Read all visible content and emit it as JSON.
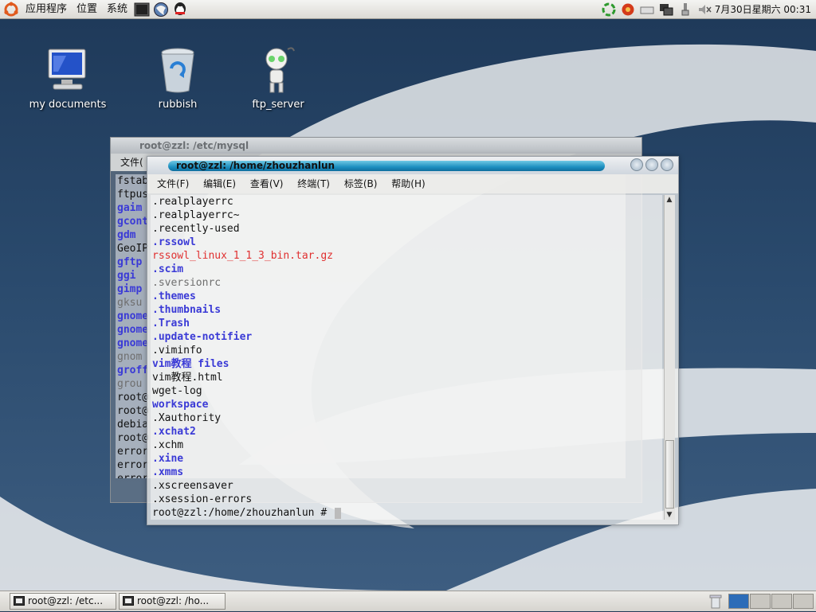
{
  "top_panel": {
    "menus": [
      "应用程序",
      "位置",
      "系统"
    ],
    "clock": "7月30日星期六 00:31"
  },
  "desktop_icons": [
    {
      "label": "my documents",
      "icon": "computer-icon"
    },
    {
      "label": "rubbish",
      "icon": "trash-icon"
    },
    {
      "label": "ftp_server",
      "icon": "robot-icon"
    }
  ],
  "window_mysql": {
    "title": "root@zzl: /etc/mysql",
    "menu_first": "文件(",
    "lines": [
      {
        "text": "fstab",
        "color": "white"
      },
      {
        "text": "ftpus",
        "color": "white"
      },
      {
        "text": "gaim",
        "color": "blue"
      },
      {
        "text": "gcont",
        "color": "blue"
      },
      {
        "text": "gdm",
        "color": "blue"
      },
      {
        "text": "GeoIP",
        "color": "white"
      },
      {
        "text": "gftp",
        "color": "blue"
      },
      {
        "text": "ggi",
        "color": "blue"
      },
      {
        "text": "gimp",
        "color": "blue"
      },
      {
        "text": "gksu",
        "color": "grey"
      },
      {
        "text": "gnome",
        "color": "blue"
      },
      {
        "text": "gnome",
        "color": "blue"
      },
      {
        "text": "gnome",
        "color": "blue"
      },
      {
        "text": "gnom",
        "color": "grey"
      },
      {
        "text": "groff",
        "color": "blue"
      },
      {
        "text": "grou",
        "color": "grey"
      },
      {
        "text": "root@",
        "color": "white"
      },
      {
        "text": "root@",
        "color": "white"
      },
      {
        "text": "debia",
        "color": "white"
      },
      {
        "text": "root@",
        "color": "white"
      },
      {
        "text": "error",
        "color": "white"
      },
      {
        "text": "error",
        "color": "white"
      },
      {
        "text": "error",
        "color": "white"
      }
    ]
  },
  "window_home": {
    "title": "root@zzl: /home/zhouzhanlun",
    "menu": [
      "文件(F)",
      "编辑(E)",
      "查看(V)",
      "终端(T)",
      "标签(B)",
      "帮助(H)"
    ],
    "lines": [
      {
        "text": ".realplayerrc",
        "color": "white"
      },
      {
        "text": ".realplayerrc~",
        "color": "white"
      },
      {
        "text": ".recently-used",
        "color": "white"
      },
      {
        "text": ".rssowl",
        "color": "blue"
      },
      {
        "text": "rssowl_linux_1_1_3_bin.tar.gz",
        "color": "red"
      },
      {
        "text": ".scim",
        "color": "blue"
      },
      {
        "text": ".sversionrc",
        "color": "grey"
      },
      {
        "text": ".themes",
        "color": "blue"
      },
      {
        "text": ".thumbnails",
        "color": "blue"
      },
      {
        "text": ".Trash",
        "color": "blue"
      },
      {
        "text": ".update-notifier",
        "color": "blue"
      },
      {
        "text": ".viminfo",
        "color": "white"
      },
      {
        "text": "vim教程 files",
        "color": "blue"
      },
      {
        "text": "vim教程.html",
        "color": "white"
      },
      {
        "text": "wget-log",
        "color": "white"
      },
      {
        "text": "workspace",
        "color": "blue"
      },
      {
        "text": ".Xauthority",
        "color": "white"
      },
      {
        "text": ".xchat2",
        "color": "blue"
      },
      {
        "text": ".xchm",
        "color": "white"
      },
      {
        "text": ".xine",
        "color": "blue"
      },
      {
        "text": ".xmms",
        "color": "blue"
      },
      {
        "text": ".xscreensaver",
        "color": "white"
      },
      {
        "text": ".xsession-errors",
        "color": "white"
      }
    ],
    "prompt": "root@zzl:/home/zhouzhanlun # "
  },
  "taskbar": {
    "tasks": [
      "root@zzl: /etc...",
      "root@zzl: /ho..."
    ]
  }
}
